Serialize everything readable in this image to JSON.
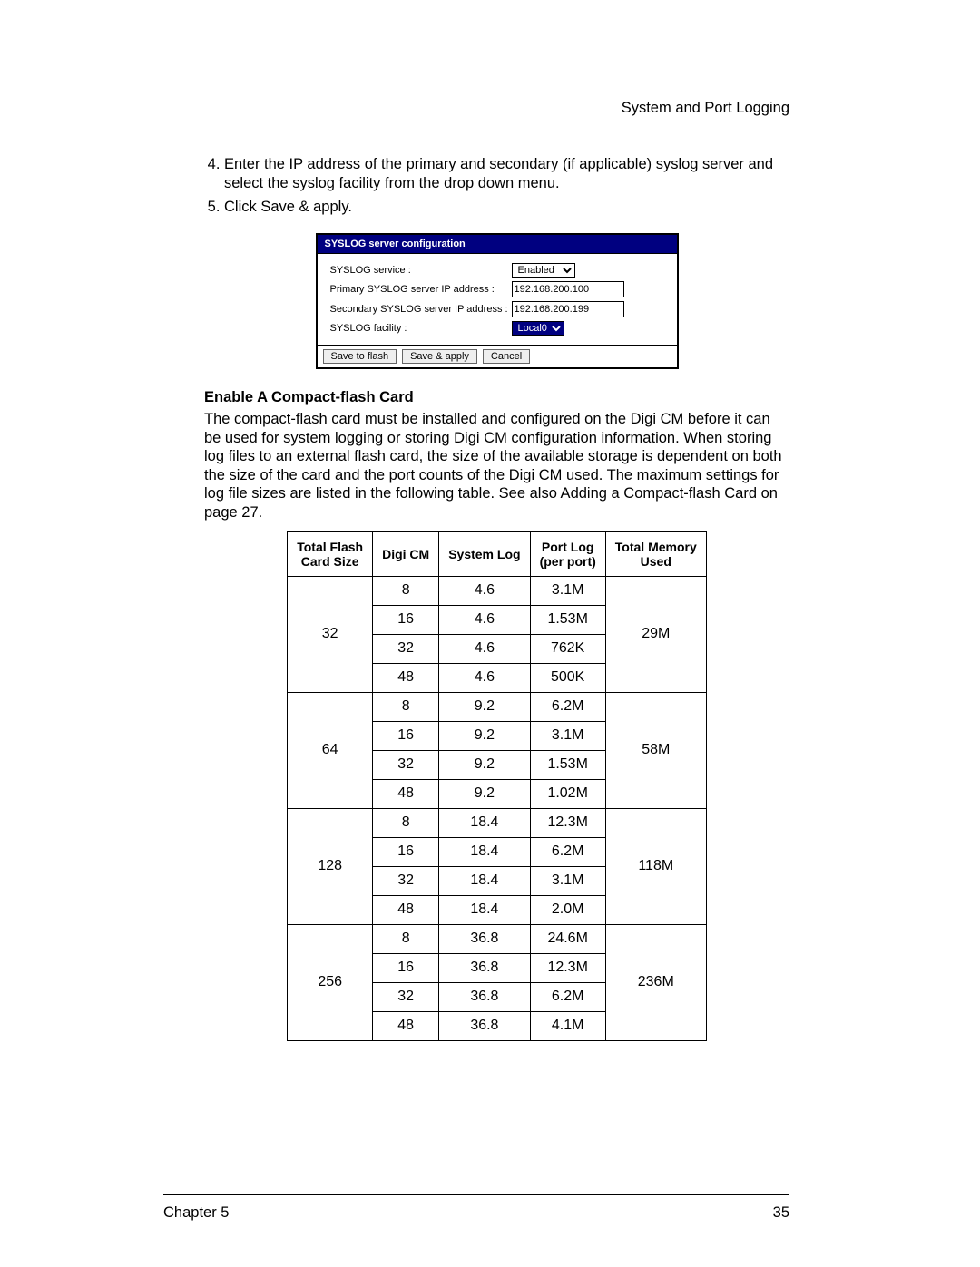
{
  "header_section": "System and Port Logging",
  "steps": {
    "s4": "Enter the IP address of the primary and secondary (if applicable) syslog server and select the syslog facility from the drop down menu.",
    "s5_prefix": "Click ",
    "s5_cmd": "Save & apply"
  },
  "syslog_ui": {
    "title": "SYSLOG server configuration",
    "rows": {
      "service_label": "SYSLOG service :",
      "service_value": "Enabled",
      "primary_label": "Primary SYSLOG server IP address :",
      "primary_value": "192.168.200.100",
      "secondary_label": "Secondary SYSLOG server IP address :",
      "secondary_value": "192.168.200.199",
      "facility_label": "SYSLOG facility :",
      "facility_value": "Local0"
    },
    "buttons": {
      "save_flash": "Save to flash",
      "save_apply": "Save & apply",
      "cancel": "Cancel"
    }
  },
  "subheading": "Enable A Compact-flash Card",
  "paragraph": "The compact-flash card must be installed and configured on the Digi CM before it can be used for system logging or storing Digi CM configuration information. When storing log files to an external flash card, the size of the available storage is dependent on both the size of the card and the port counts of the Digi CM used. The maximum settings for log file sizes are listed in the following table. See also Adding a Compact-flash Card on page 27.",
  "chart_data": {
    "type": "table",
    "headers": [
      "Total Flash Card Size",
      "Digi CM",
      "System Log",
      "Port Log (per port)",
      "Total Memory Used"
    ],
    "groups": [
      {
        "size": "32",
        "total": "29M",
        "rows": [
          {
            "cm": "8",
            "sys": "4.6",
            "port": "3.1M"
          },
          {
            "cm": "16",
            "sys": "4.6",
            "port": "1.53M"
          },
          {
            "cm": "32",
            "sys": "4.6",
            "port": "762K"
          },
          {
            "cm": "48",
            "sys": "4.6",
            "port": "500K"
          }
        ]
      },
      {
        "size": "64",
        "total": "58M",
        "rows": [
          {
            "cm": "8",
            "sys": "9.2",
            "port": "6.2M"
          },
          {
            "cm": "16",
            "sys": "9.2",
            "port": "3.1M"
          },
          {
            "cm": "32",
            "sys": "9.2",
            "port": "1.53M"
          },
          {
            "cm": "48",
            "sys": "9.2",
            "port": "1.02M"
          }
        ]
      },
      {
        "size": "128",
        "total": "118M",
        "rows": [
          {
            "cm": "8",
            "sys": "18.4",
            "port": "12.3M"
          },
          {
            "cm": "16",
            "sys": "18.4",
            "port": "6.2M"
          },
          {
            "cm": "32",
            "sys": "18.4",
            "port": "3.1M"
          },
          {
            "cm": "48",
            "sys": "18.4",
            "port": "2.0M"
          }
        ]
      },
      {
        "size": "256",
        "total": "236M",
        "rows": [
          {
            "cm": "8",
            "sys": "36.8",
            "port": "24.6M"
          },
          {
            "cm": "16",
            "sys": "36.8",
            "port": "12.3M"
          },
          {
            "cm": "32",
            "sys": "36.8",
            "port": "6.2M"
          },
          {
            "cm": "48",
            "sys": "36.8",
            "port": "4.1M"
          }
        ]
      }
    ]
  },
  "footer": {
    "chapter": "Chapter 5",
    "page": "35"
  }
}
